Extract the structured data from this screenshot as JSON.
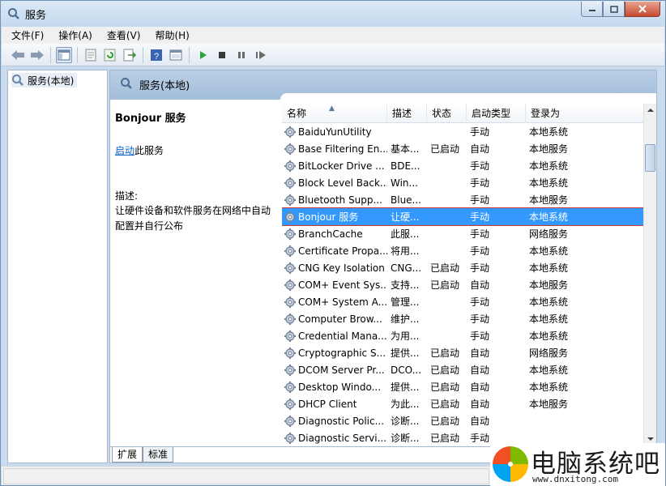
{
  "window": {
    "title": "服务"
  },
  "menu": [
    "文件(F)",
    "操作(A)",
    "查看(V)",
    "帮助(H)"
  ],
  "toolbar": [
    "back-icon",
    "forward-icon",
    "show-tree-icon",
    "properties-icon",
    "refresh-icon",
    "export-icon",
    "help-icon",
    "console-icon",
    "start-icon",
    "stop-icon",
    "pause-icon",
    "restart-icon"
  ],
  "tree": {
    "root_label": "服务(本地)"
  },
  "panel": {
    "header": "服务(本地)"
  },
  "description": {
    "title": "Bonjour 服务",
    "start_link": "启动",
    "start_suffix": "此服务",
    "label": "描述:",
    "text": "让硬件设备和软件服务在网络中自动配置并自行公布"
  },
  "columns": [
    "名称",
    "描述",
    "状态",
    "启动类型",
    "登录为"
  ],
  "services": [
    {
      "name": "BaiduYunUtility",
      "desc": "",
      "state": "",
      "start": "手动",
      "logon": "本地系统"
    },
    {
      "name": "Base Filtering En...",
      "desc": "基本...",
      "state": "已启动",
      "start": "自动",
      "logon": "本地服务"
    },
    {
      "name": "BitLocker Drive ...",
      "desc": "BDE...",
      "state": "",
      "start": "手动",
      "logon": "本地系统"
    },
    {
      "name": "Block Level Back...",
      "desc": "Win...",
      "state": "",
      "start": "手动",
      "logon": "本地系统"
    },
    {
      "name": "Bluetooth Supp...",
      "desc": "Blue...",
      "state": "",
      "start": "手动",
      "logon": "本地服务"
    },
    {
      "name": "Bonjour 服务",
      "desc": "让硬...",
      "state": "",
      "start": "手动",
      "logon": "本地系统",
      "selected": true
    },
    {
      "name": "BranchCache",
      "desc": "此服...",
      "state": "",
      "start": "手动",
      "logon": "网络服务"
    },
    {
      "name": "Certificate Propa...",
      "desc": "将用...",
      "state": "",
      "start": "手动",
      "logon": "本地系统"
    },
    {
      "name": "CNG Key Isolation",
      "desc": "CNG...",
      "state": "已启动",
      "start": "手动",
      "logon": "本地系统"
    },
    {
      "name": "COM+ Event Sys...",
      "desc": "支持...",
      "state": "已启动",
      "start": "自动",
      "logon": "本地服务"
    },
    {
      "name": "COM+ System A...",
      "desc": "管理...",
      "state": "",
      "start": "手动",
      "logon": "本地系统"
    },
    {
      "name": "Computer Brow...",
      "desc": "维护...",
      "state": "",
      "start": "手动",
      "logon": "本地系统"
    },
    {
      "name": "Credential Mana...",
      "desc": "为用...",
      "state": "",
      "start": "手动",
      "logon": "本地系统"
    },
    {
      "name": "Cryptographic S...",
      "desc": "提供...",
      "state": "已启动",
      "start": "自动",
      "logon": "网络服务"
    },
    {
      "name": "DCOM Server Pr...",
      "desc": "DCO...",
      "state": "已启动",
      "start": "自动",
      "logon": "本地系统"
    },
    {
      "name": "Desktop Windo...",
      "desc": "提供...",
      "state": "已启动",
      "start": "自动",
      "logon": "本地系统"
    },
    {
      "name": "DHCP Client",
      "desc": "为此...",
      "state": "已启动",
      "start": "自动",
      "logon": "本地服务"
    },
    {
      "name": "Diagnostic Polic...",
      "desc": "诊断...",
      "state": "已启动",
      "start": "自动",
      "logon": ""
    },
    {
      "name": "Diagnostic Servi...",
      "desc": "诊断...",
      "state": "已启动",
      "start": "手动",
      "logon": ""
    }
  ],
  "tabs": [
    "扩展",
    "标准"
  ],
  "watermark": {
    "cn": "电脑系统吧",
    "url": "www.dnxitong.com"
  }
}
